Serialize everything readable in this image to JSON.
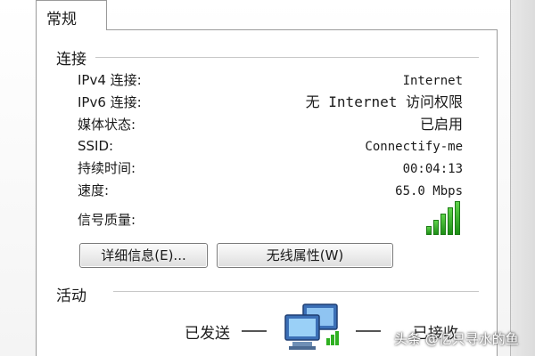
{
  "tab": {
    "label": "常规"
  },
  "connection": {
    "title": "连接",
    "rows": [
      {
        "label": "IPv4 连接:",
        "value": "Internet"
      },
      {
        "label": "IPv6 连接:",
        "value": "无 Internet 访问权限"
      },
      {
        "label": "媒体状态:",
        "value": "已启用"
      },
      {
        "label": "SSID:",
        "value": "Connectify-me"
      },
      {
        "label": "持续时间:",
        "value": "00:04:13"
      },
      {
        "label": "速度:",
        "value": "65.0 Mbps"
      }
    ],
    "signal_label": "信号质量:",
    "signal_icon": "signal-strength-icon",
    "signal_bars_filled": 5,
    "signal_bars_total": 5
  },
  "buttons": {
    "details": "详细信息(E)...",
    "wireless": "无线属性(W)"
  },
  "activity": {
    "title": "活动",
    "sent_label": "已发送",
    "received_label": "已接收",
    "icon": "network-computers-icon"
  },
  "watermark": "头条 @亿只寻水的鱼",
  "colors": {
    "signal_green": "#2fb021",
    "border": "#9a9a9a"
  }
}
